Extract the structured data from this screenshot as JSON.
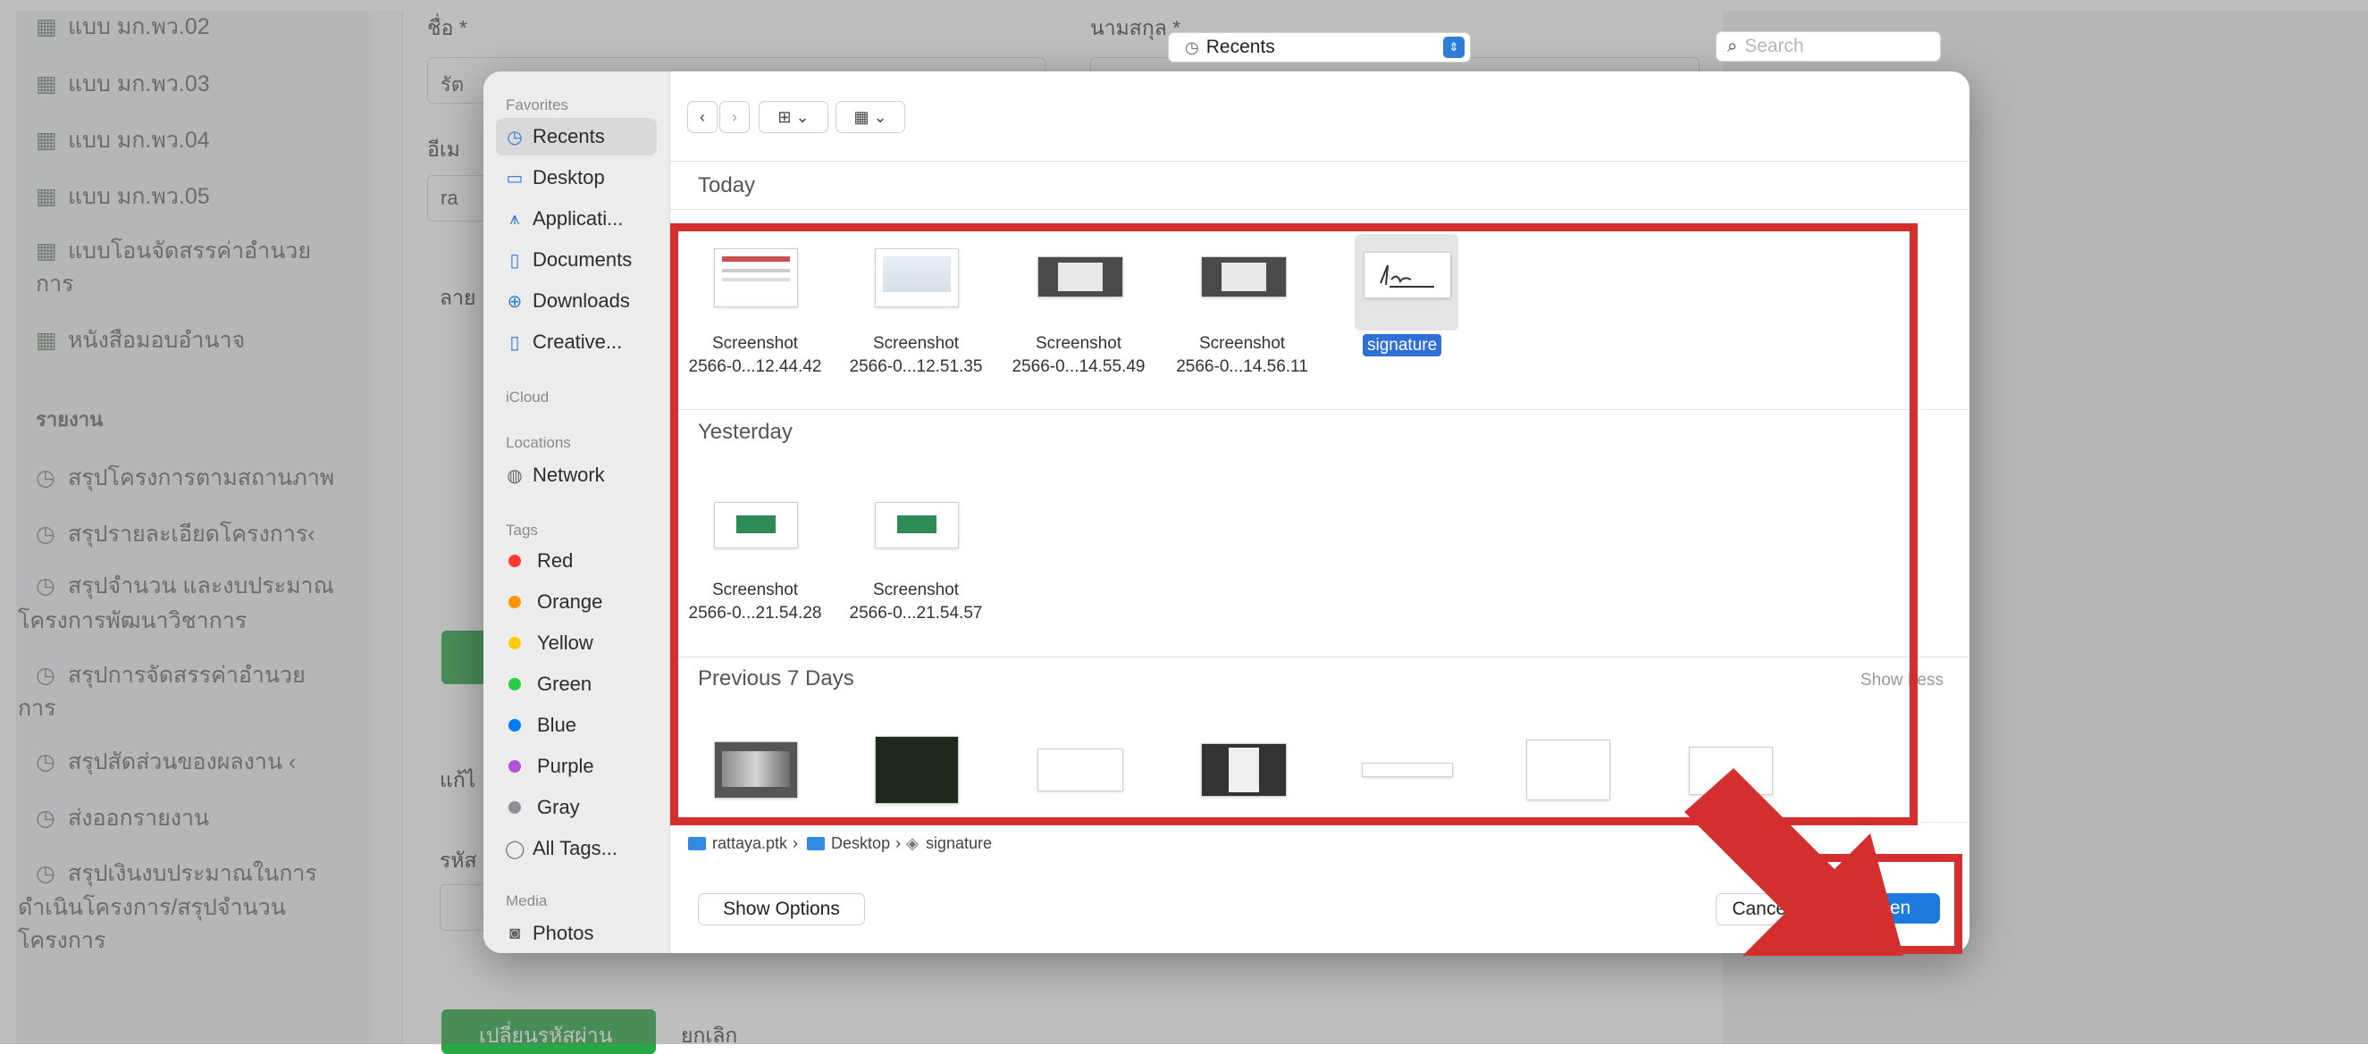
{
  "background": {
    "sidebar_items": [
      {
        "label": "แบบ มก.พว.02",
        "icon": "table-icon"
      },
      {
        "label": "แบบ มก.พว.03",
        "icon": "table-icon"
      },
      {
        "label": "แบบ มก.พว.04",
        "icon": "table-icon"
      },
      {
        "label": "แบบ มก.พว.05",
        "icon": "table-icon"
      },
      {
        "label": "แบบโอนจัดสรรค่าอำนวย",
        "icon": "table-icon"
      },
      {
        "label": "การ",
        "icon": ""
      },
      {
        "label": "หนังสือมอบอำนาจ",
        "icon": "table-icon"
      }
    ],
    "reports_heading": "รายงาน",
    "report_items": [
      {
        "label": "สรุปโครงการตามสถานภาพ",
        "icon": "clock-icon"
      },
      {
        "label": "สรุปรายละเอียดโครงการ‹",
        "icon": "clock-icon"
      },
      {
        "label": "สรุปจำนวน และงบประมาณ",
        "icon": "clock-icon"
      },
      {
        "label": "โครงการพัฒนาวิชาการ",
        "icon": ""
      },
      {
        "label": "สรุปการจัดสรรค่าอำนวย",
        "icon": "clock-icon"
      },
      {
        "label": "การ",
        "icon": ""
      },
      {
        "label": "สรุปสัดส่วนของผลงาน  ‹",
        "icon": "clock-icon"
      },
      {
        "label": "ส่งออกรายงาน",
        "icon": "clock-icon"
      },
      {
        "label": "สรุปเงินงบประมาณในการ",
        "icon": "clock-icon"
      },
      {
        "label": "ดำเนินโครงการ/สรุปจำนวน",
        "icon": ""
      },
      {
        "label": "โครงการ",
        "icon": ""
      }
    ],
    "form": {
      "first_name_label": "ชื่อ *",
      "last_name_label": "นามสกุล *",
      "first_name_value": "รัต",
      "email_label": "อีเม",
      "email_value": "ra",
      "signature_label": "ลาย",
      "edit_label": "แก้ไ",
      "code_label": "รหัส",
      "change_password_button": "เปลี่ยนรหัสผ่าน",
      "cancel_link": "ยกเลิก"
    }
  },
  "dialog": {
    "sidebar": {
      "favorites_heading": "Favorites",
      "favorites": [
        {
          "label": "Recents",
          "icon": "clock-icon",
          "selected": true
        },
        {
          "label": "Desktop",
          "icon": "desktop-icon",
          "selected": false
        },
        {
          "label": "Applicati...",
          "icon": "applications-icon",
          "selected": false
        },
        {
          "label": "Documents",
          "icon": "document-icon",
          "selected": false
        },
        {
          "label": "Downloads",
          "icon": "download-icon",
          "selected": false
        },
        {
          "label": "Creative...",
          "icon": "file-icon",
          "selected": false
        }
      ],
      "icloud_heading": "iCloud",
      "locations_heading": "Locations",
      "locations": [
        {
          "label": "Network",
          "icon": "globe-icon"
        }
      ],
      "tags_heading": "Tags",
      "tags": [
        {
          "label": "Red",
          "color": "#ff3b30"
        },
        {
          "label": "Orange",
          "color": "#ff9500"
        },
        {
          "label": "Yellow",
          "color": "#ffcc00"
        },
        {
          "label": "Green",
          "color": "#28cd41"
        },
        {
          "label": "Blue",
          "color": "#007aff"
        },
        {
          "label": "Purple",
          "color": "#af52de"
        },
        {
          "label": "Gray",
          "color": "#8e8e93"
        }
      ],
      "all_tags": "All Tags...",
      "media_heading": "Media",
      "media": [
        {
          "label": "Photos",
          "icon": "camera-icon"
        }
      ]
    },
    "toolbar": {
      "back": "‹",
      "forward": "›",
      "view_icon": "⊞ ⌄",
      "group_icon": "▦ ⌄",
      "location": "Recents",
      "search_placeholder": "Search"
    },
    "groups": {
      "today": "Today",
      "yesterday": "Yesterday",
      "previous": "Previous 7 Days",
      "show_less": "Show Less"
    },
    "today_files": [
      {
        "line1": "Screenshot",
        "line2": "2566-0...12.44.42"
      },
      {
        "line1": "Screenshot",
        "line2": "2566-0...12.51.35"
      },
      {
        "line1": "Screenshot",
        "line2": "2566-0...14.55.49"
      },
      {
        "line1": "Screenshot",
        "line2": "2566-0...14.56.11"
      }
    ],
    "selected_file": "signature",
    "yesterday_files": [
      {
        "line1": "Screenshot",
        "line2": "2566-0...21.54.28"
      },
      {
        "line1": "Screenshot",
        "line2": "2566-0...21.54.57"
      }
    ],
    "path": {
      "user": "rattaya.ptk",
      "sep": "›",
      "folder": "Desktop",
      "file": "signature"
    },
    "show_options": "Show Options",
    "cancel": "Cancel",
    "open": "Open"
  },
  "annotation_color": "#d32f2f"
}
